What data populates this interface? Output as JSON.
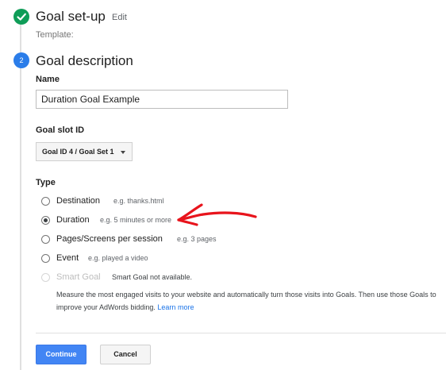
{
  "step1": {
    "title": "Goal set-up",
    "edit_label": "Edit",
    "template_label": "Template:"
  },
  "step2": {
    "number": "2",
    "title": "Goal description"
  },
  "name_field": {
    "label": "Name",
    "value": "Duration Goal Example"
  },
  "goal_slot": {
    "label": "Goal slot ID",
    "selected": "Goal ID 4 / Goal Set 1"
  },
  "type": {
    "label": "Type",
    "options": [
      {
        "label": "Destination",
        "hint": "e.g. thanks.html"
      },
      {
        "label": "Duration",
        "hint": "e.g. 5 minutes or more"
      },
      {
        "label": "Pages/Screens per session",
        "hint": "e.g. 3 pages"
      },
      {
        "label": "Event",
        "hint": "e.g. played a video"
      },
      {
        "label": "Smart Goal",
        "hint": "Smart Goal not available."
      }
    ],
    "selected": "Duration",
    "smart_goal_description": "Measure the most engaged visits to your website and automatically turn those visits into Goals. Then use those Goals to improve your AdWords bidding.",
    "learn_more": "Learn more"
  },
  "buttons": {
    "continue": "Continue",
    "cancel": "Cancel"
  },
  "colors": {
    "done_green": "#0f9d58",
    "step_blue": "#2b7de9",
    "primary_button": "#4285f4",
    "annotation_red": "#e8141c"
  },
  "icons": {
    "step1": "check-icon",
    "select": "chevron-down-icon",
    "annotation": "arrow-annotation"
  }
}
